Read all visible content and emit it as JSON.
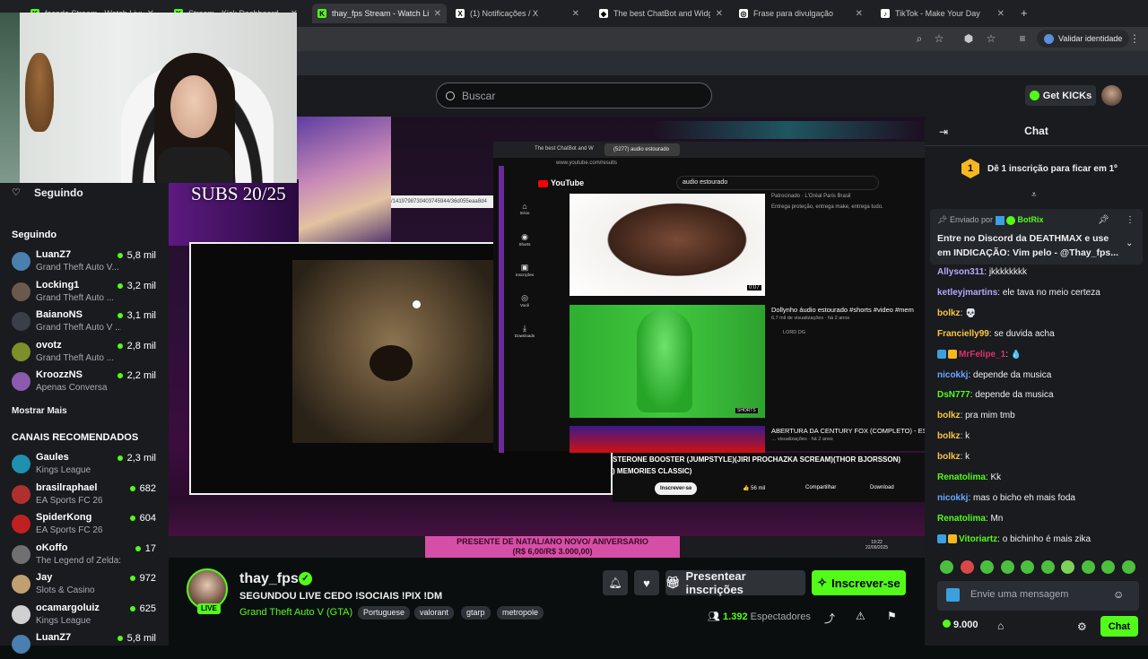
{
  "browser": {
    "tabs": [
      {
        "title": "facada Stream - Watch Live o",
        "fav": "K",
        "color": "#53fc18",
        "active": false
      },
      {
        "title": "Stream - Kick Dashboard",
        "fav": "K",
        "color": "#53fc18",
        "active": false
      },
      {
        "title": "thay_fps Stream - Watch Live o",
        "fav": "K",
        "color": "#53fc18",
        "active": true
      },
      {
        "title": "(1) Notificações / X",
        "fav": "X",
        "color": "#ffffff",
        "active": false
      },
      {
        "title": "The best ChatBot and Widgets",
        "fav": "◆",
        "color": "#ffffff",
        "active": false
      },
      {
        "title": "Frase para divulgação",
        "fav": "◎",
        "color": "#ffffff",
        "active": false
      },
      {
        "title": "TikTok - Make Your Day",
        "fav": "♪",
        "color": "#ffffff",
        "active": false
      }
    ],
    "verify_label": "Validar identidade"
  },
  "nav": {
    "search_placeholder": "Buscar",
    "get_kicks": "Get KICKs"
  },
  "sidebar": {
    "following_header": "Seguindo",
    "following_section": "Seguindo",
    "following": [
      {
        "name": "LuanZ7",
        "game": "Grand Theft Auto V...",
        "viewers": "5,8 mil",
        "color": "#4a7fb0"
      },
      {
        "name": "Locking1",
        "game": "Grand Theft Auto ...",
        "viewers": "3,2 mil",
        "color": "#6b5a4c"
      },
      {
        "name": "BaianoNS",
        "game": "Grand Theft Auto V ...",
        "viewers": "3,1 mil",
        "color": "#3b3f4a"
      },
      {
        "name": "ovotz",
        "game": "Grand Theft Auto ...",
        "viewers": "2,8 mil",
        "color": "#7c8f2a"
      },
      {
        "name": "KroozzNS",
        "game": "Apenas Conversa",
        "viewers": "2,2 mil",
        "color": "#8b5bb0"
      }
    ],
    "show_more": "Mostrar Mais",
    "recommended_section": "CANAIS RECOMENDADOS",
    "recommended": [
      {
        "name": "Gaules",
        "game": "Kings League",
        "viewers": "2,3 mil",
        "color": "#1e90b0"
      },
      {
        "name": "brasilraphael",
        "game": "EA Sports FC 26",
        "viewers": "682",
        "color": "#b03030"
      },
      {
        "name": "SpiderKong",
        "game": "EA Sports FC 26",
        "viewers": "604",
        "color": "#c02020"
      },
      {
        "name": "oKoffo",
        "game": "The Legend of Zelda: Ec...",
        "viewers": "17",
        "color": "#707070"
      },
      {
        "name": "Jay",
        "game": "Slots & Casino",
        "viewers": "972",
        "color": "#c0a070"
      },
      {
        "name": "ocamargoluiz",
        "game": "Kings League",
        "viewers": "625",
        "color": "#d0d0d0"
      },
      {
        "name": "LuanZ7",
        "game": "",
        "viewers": "5,8 mil",
        "color": "#4a7fb0"
      }
    ]
  },
  "stream": {
    "overlay_subs": "SUBS 20/25",
    "yt_search": "audio estourado",
    "yt_tab": "(5277) audio estourado",
    "yt_tab2": "The best ChatBot and W",
    "yt_url": "www.youtube.com/results",
    "yt_logo": "YouTube",
    "ad_label": "Patrocinado · L'Oréal Paris Brasil",
    "ad_desc": "Entrega proteção, entrega make, entrega tudo.",
    "ad_duration": "0:07",
    "video1_title": "Dollynho áudio estourado #shorts #video #mem",
    "video1_meta": "6,7 mil de visualizações · há 2 anos",
    "video1_channel": "LORD DG",
    "shorts_badge": "SHORTS",
    "video2_title": "ABERTURA DA CENTURY FOX (COMPLETO) - ES",
    "video2_meta": "… visualizações · há 2 anos",
    "now_playing_line1": "STERONE BOOSTER (JUMPSTYLE)(JIRI PROCHAZKA SCREAM)(THOR BJORSSON)",
    "now_playing_line2": ") MEMORIES CLASSIC)",
    "subscribe_btn": "Inscrever-se",
    "likes": "56 mil",
    "share": "Compartilhar",
    "download": "Download",
    "sidebar_icons": [
      "Início",
      "Shorts",
      "Inscrições",
      "Você",
      "Downloads"
    ],
    "banner_line1": "PRESENTE DE NATAL/ANO NOVO/ ANIVERSARIO",
    "banner_line2": "(R$ 6,00/R$ 3.000,00)",
    "clock": "19:22",
    "date": "22/09/2025",
    "code_fragment": "/1419798730403745944/36d055eaa8d4"
  },
  "channel": {
    "name": "thay_fps",
    "title": "SEGUNDOU LIVE CEDO !SOCIAIS !PIX !DM",
    "category": "Grand Theft Auto V (GTA)",
    "tags": [
      "Portuguese",
      "valorant",
      "gtarp",
      "metropole"
    ],
    "live_badge": "LIVE",
    "gift_btn": "Presentear inscrições",
    "subscribe_btn": "Inscrever-se",
    "viewers_count": "1.392",
    "viewers_label": "Espectadores"
  },
  "chat": {
    "title": "Chat",
    "sub_goal": "Dê 1 inscrição para ficar em 1º",
    "sub_goal_rank": "1",
    "pinned_by_label": "Enviado por",
    "pinned_by": "BotRix",
    "pinned_text_1": "Entre no Discord da DEATHMAX e use",
    "pinned_text_2": "em INDICAÇÃO: Vim pelo - @Thay_fps...",
    "messages": [
      {
        "user": "Allyson311",
        "text": "jkkkkkkkk",
        "color": "#b8a6ff",
        "badges": false
      },
      {
        "user": "ketleyjmartins",
        "text": "ele tava no meio certeza",
        "color": "#b8a6ff",
        "badges": false
      },
      {
        "user": "bolkz",
        "text": "💀",
        "color": "#f9c642",
        "badges": false
      },
      {
        "user": "Francielly99",
        "text": "se duvida acha",
        "color": "#f9c642",
        "badges": false
      },
      {
        "user": "MrFelipe_1",
        "text": "💧",
        "color": "#e0306a",
        "badges": true
      },
      {
        "user": "nicokkj",
        "text": "depende da musica",
        "color": "#6aa8ff",
        "badges": false
      },
      {
        "user": "DsN777",
        "text": "depende da musica",
        "color": "#53fc18",
        "badges": false
      },
      {
        "user": "bolkz",
        "text": "pra mim tmb",
        "color": "#f9c642",
        "badges": false
      },
      {
        "user": "bolkz",
        "text": "k",
        "color": "#f9c642",
        "badges": false
      },
      {
        "user": "bolkz",
        "text": "k",
        "color": "#f9c642",
        "badges": false
      },
      {
        "user": "Renatolima",
        "text": "Kk",
        "color": "#53fc18",
        "badges": false
      },
      {
        "user": "nicokkj",
        "text": "mas o bicho eh mais foda",
        "color": "#6aa8ff",
        "badges": false
      },
      {
        "user": "Renatolima",
        "text": "Mn",
        "color": "#53fc18",
        "badges": false
      },
      {
        "user": "Vitoriartz",
        "text": "o bichinho é mais zika",
        "color": "#53fc18",
        "badges": true
      }
    ],
    "input_placeholder": "Envie uma mensagem",
    "balance": "9.000",
    "send_btn": "Chat"
  },
  "colors": {
    "kick_green": "#53fc18",
    "bg": "#0b0e0f",
    "panel": "#191b1f"
  }
}
